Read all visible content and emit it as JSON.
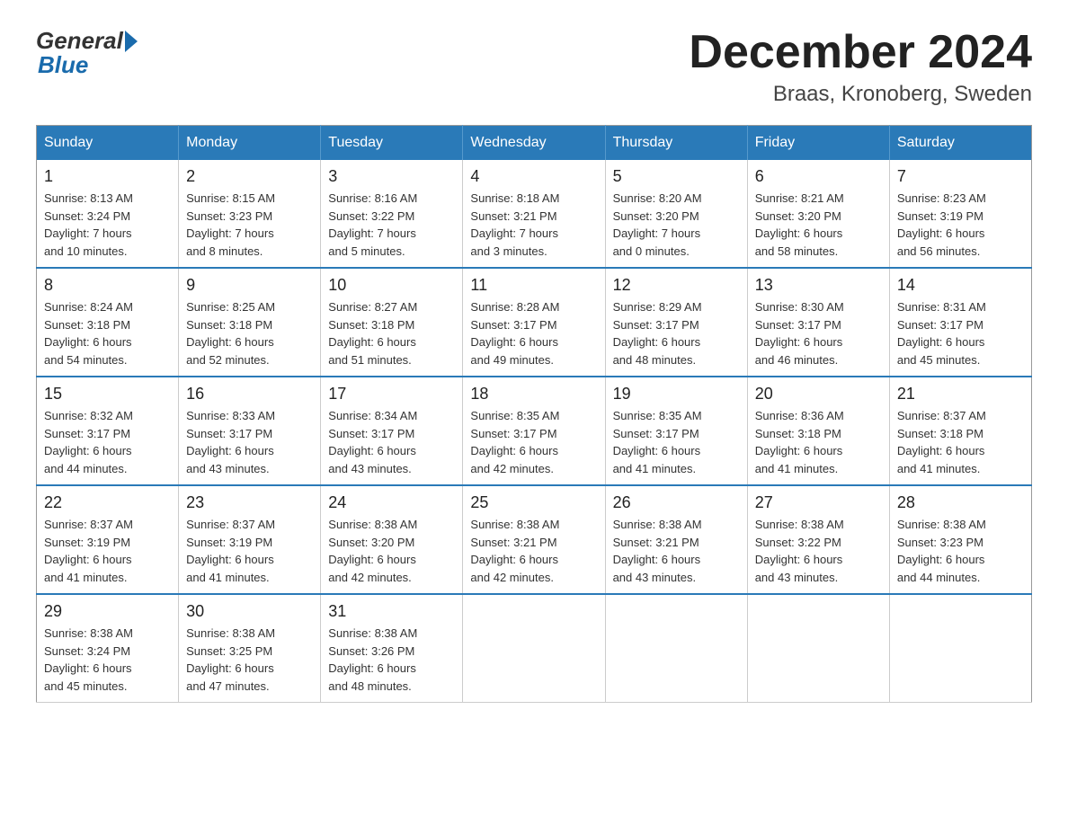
{
  "logo": {
    "general": "General",
    "blue": "Blue"
  },
  "title": "December 2024",
  "subtitle": "Braas, Kronoberg, Sweden",
  "headers": [
    "Sunday",
    "Monday",
    "Tuesday",
    "Wednesday",
    "Thursday",
    "Friday",
    "Saturday"
  ],
  "weeks": [
    [
      {
        "day": "1",
        "sunrise": "8:13 AM",
        "sunset": "3:24 PM",
        "daylight": "7 hours and 10 minutes."
      },
      {
        "day": "2",
        "sunrise": "8:15 AM",
        "sunset": "3:23 PM",
        "daylight": "7 hours and 8 minutes."
      },
      {
        "day": "3",
        "sunrise": "8:16 AM",
        "sunset": "3:22 PM",
        "daylight": "7 hours and 5 minutes."
      },
      {
        "day": "4",
        "sunrise": "8:18 AM",
        "sunset": "3:21 PM",
        "daylight": "7 hours and 3 minutes."
      },
      {
        "day": "5",
        "sunrise": "8:20 AM",
        "sunset": "3:20 PM",
        "daylight": "7 hours and 0 minutes."
      },
      {
        "day": "6",
        "sunrise": "8:21 AM",
        "sunset": "3:20 PM",
        "daylight": "6 hours and 58 minutes."
      },
      {
        "day": "7",
        "sunrise": "8:23 AM",
        "sunset": "3:19 PM",
        "daylight": "6 hours and 56 minutes."
      }
    ],
    [
      {
        "day": "8",
        "sunrise": "8:24 AM",
        "sunset": "3:18 PM",
        "daylight": "6 hours and 54 minutes."
      },
      {
        "day": "9",
        "sunrise": "8:25 AM",
        "sunset": "3:18 PM",
        "daylight": "6 hours and 52 minutes."
      },
      {
        "day": "10",
        "sunrise": "8:27 AM",
        "sunset": "3:18 PM",
        "daylight": "6 hours and 51 minutes."
      },
      {
        "day": "11",
        "sunrise": "8:28 AM",
        "sunset": "3:17 PM",
        "daylight": "6 hours and 49 minutes."
      },
      {
        "day": "12",
        "sunrise": "8:29 AM",
        "sunset": "3:17 PM",
        "daylight": "6 hours and 48 minutes."
      },
      {
        "day": "13",
        "sunrise": "8:30 AM",
        "sunset": "3:17 PM",
        "daylight": "6 hours and 46 minutes."
      },
      {
        "day": "14",
        "sunrise": "8:31 AM",
        "sunset": "3:17 PM",
        "daylight": "6 hours and 45 minutes."
      }
    ],
    [
      {
        "day": "15",
        "sunrise": "8:32 AM",
        "sunset": "3:17 PM",
        "daylight": "6 hours and 44 minutes."
      },
      {
        "day": "16",
        "sunrise": "8:33 AM",
        "sunset": "3:17 PM",
        "daylight": "6 hours and 43 minutes."
      },
      {
        "day": "17",
        "sunrise": "8:34 AM",
        "sunset": "3:17 PM",
        "daylight": "6 hours and 43 minutes."
      },
      {
        "day": "18",
        "sunrise": "8:35 AM",
        "sunset": "3:17 PM",
        "daylight": "6 hours and 42 minutes."
      },
      {
        "day": "19",
        "sunrise": "8:35 AM",
        "sunset": "3:17 PM",
        "daylight": "6 hours and 41 minutes."
      },
      {
        "day": "20",
        "sunrise": "8:36 AM",
        "sunset": "3:18 PM",
        "daylight": "6 hours and 41 minutes."
      },
      {
        "day": "21",
        "sunrise": "8:37 AM",
        "sunset": "3:18 PM",
        "daylight": "6 hours and 41 minutes."
      }
    ],
    [
      {
        "day": "22",
        "sunrise": "8:37 AM",
        "sunset": "3:19 PM",
        "daylight": "6 hours and 41 minutes."
      },
      {
        "day": "23",
        "sunrise": "8:37 AM",
        "sunset": "3:19 PM",
        "daylight": "6 hours and 41 minutes."
      },
      {
        "day": "24",
        "sunrise": "8:38 AM",
        "sunset": "3:20 PM",
        "daylight": "6 hours and 42 minutes."
      },
      {
        "day": "25",
        "sunrise": "8:38 AM",
        "sunset": "3:21 PM",
        "daylight": "6 hours and 42 minutes."
      },
      {
        "day": "26",
        "sunrise": "8:38 AM",
        "sunset": "3:21 PM",
        "daylight": "6 hours and 43 minutes."
      },
      {
        "day": "27",
        "sunrise": "8:38 AM",
        "sunset": "3:22 PM",
        "daylight": "6 hours and 43 minutes."
      },
      {
        "day": "28",
        "sunrise": "8:38 AM",
        "sunset": "3:23 PM",
        "daylight": "6 hours and 44 minutes."
      }
    ],
    [
      {
        "day": "29",
        "sunrise": "8:38 AM",
        "sunset": "3:24 PM",
        "daylight": "6 hours and 45 minutes."
      },
      {
        "day": "30",
        "sunrise": "8:38 AM",
        "sunset": "3:25 PM",
        "daylight": "6 hours and 47 minutes."
      },
      {
        "day": "31",
        "sunrise": "8:38 AM",
        "sunset": "3:26 PM",
        "daylight": "6 hours and 48 minutes."
      },
      null,
      null,
      null,
      null
    ]
  ]
}
